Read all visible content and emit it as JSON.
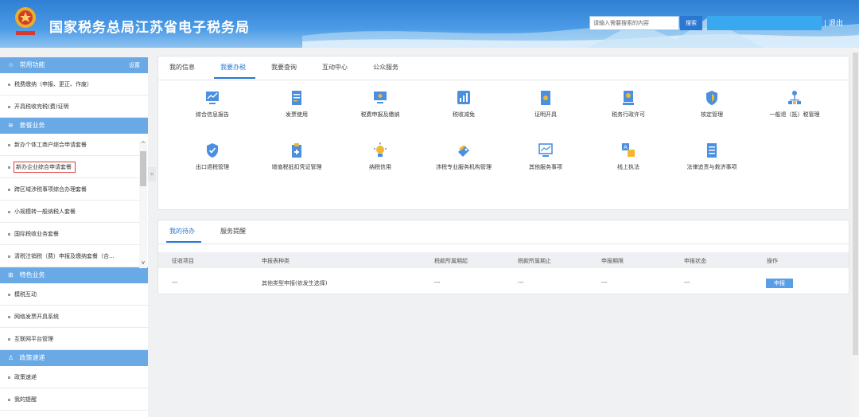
{
  "header": {
    "title": "国家税务总局江苏省电子税务局",
    "search_placeholder": "请输入需要搜索的内容",
    "search_button": "搜索",
    "logout": "| 退出",
    "emblem_icon": "tax-emblem-icon",
    "brand_color": "#2f7fd4"
  },
  "sidebar": {
    "common": {
      "title": "常用功能",
      "settings": "设置",
      "items": [
        "税费缴纳（申报、更正、作废）",
        "开具税收完税(费)证明"
      ]
    },
    "package": {
      "title": "套餐业务",
      "items": [
        "新办个体工商户综合申请套餐",
        "新办企业综合申请套餐",
        "跨区域涉税事项综合办理套餐",
        "小规模转一般纳税人套餐",
        "国际税收业务套餐",
        "清税注销税（费）申报及缴纳套餐（合..."
      ]
    },
    "special": {
      "title": "特色业务",
      "items": [
        "模税互动",
        "网络发票开具系统",
        "互联网平台管理"
      ]
    },
    "policy": {
      "title": "政策速递",
      "items": [
        "政策速递",
        "我的提醒"
      ]
    }
  },
  "main": {
    "tabs": [
      "我的信息",
      "我要办税",
      "我要查询",
      "互动中心",
      "公众服务"
    ],
    "active_tab": "我要办税",
    "services_row1": [
      "综合信息报告",
      "发票使用",
      "税费申报及缴纳",
      "税收减免",
      "证明开具",
      "税务行政许可",
      "核定管理",
      "一般退（抵）税管理"
    ],
    "services_row2": [
      "出口退税管理",
      "增值税抵扣凭证管理",
      "纳税信用",
      "涉税专业服务机构管理",
      "其他服务事项",
      "线上执法",
      "法律追责与救济事项"
    ]
  },
  "todo": {
    "tabs": [
      "我的待办",
      "服务提醒"
    ],
    "columns": [
      "征收项目",
      "申报表种类",
      "税款所属期起",
      "税款所属期止",
      "申报期限",
      "申报状态",
      "操作"
    ],
    "rows": [
      {
        "cells": [
          "---",
          "其他类型申报(依发生选择)",
          "---",
          "---",
          "---",
          "---"
        ],
        "action": "申报"
      }
    ]
  }
}
